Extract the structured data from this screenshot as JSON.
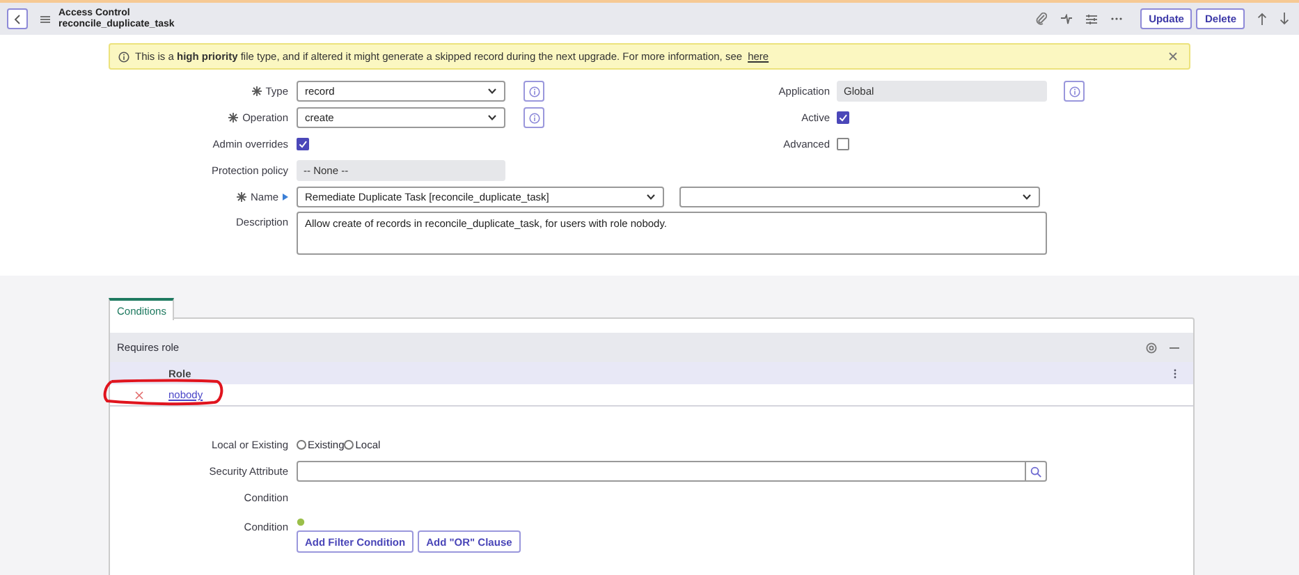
{
  "header": {
    "title": "Access Control",
    "subtitle": "reconcile_duplicate_task",
    "buttons": [
      "Update",
      "Delete"
    ]
  },
  "banner": {
    "text": "This is a **high priority** file type, and if altered it might generate a skipped record during the next upgrade. For more information, see",
    "link": "here"
  },
  "form": {
    "left": [
      {
        "kind": "select",
        "label": "Type",
        "required": true,
        "value": "record",
        "info": true
      },
      {
        "kind": "select",
        "label": "Operation",
        "required": true,
        "value": "create",
        "info": true
      },
      {
        "kind": "checkbox",
        "label": "Admin overrides",
        "checked": true
      },
      {
        "kind": "readonly",
        "label": "Protection policy",
        "value": "-- None --",
        "info": false
      }
    ],
    "right": [
      {
        "kind": "readonly",
        "label": "Application",
        "value": "Global",
        "info": true
      },
      {
        "kind": "checkbox",
        "label": "Active",
        "checked": true
      },
      {
        "kind": "checkbox",
        "label": "Advanced",
        "checked": false
      }
    ],
    "name": {
      "label": "Name",
      "required": true,
      "value": "Remediate Duplicate Task [reconcile_duplicate_task]"
    },
    "description": {
      "label": "Description",
      "value": "Allow create of records in reconcile_duplicate_task, for users with role nobody."
    }
  },
  "tabs": [
    {
      "label": "Conditions",
      "selected": true
    }
  ],
  "related_list": {
    "title": "Requires role",
    "columns": [
      "Role"
    ],
    "rows": [
      {
        "role": "nobody"
      }
    ]
  },
  "conditions": {
    "local_or_existing": {
      "label": "Local or Existing",
      "options": [
        {
          "label": "Existing",
          "selected": false
        },
        {
          "label": "Local",
          "selected": false
        }
      ]
    },
    "security_attribute": {
      "label": "Security Attribute"
    },
    "condition_label": "Condition",
    "condition_builder": {
      "label": "Condition",
      "buttons": [
        "Add Filter Condition",
        "Add \"OR\" Clause"
      ]
    }
  }
}
